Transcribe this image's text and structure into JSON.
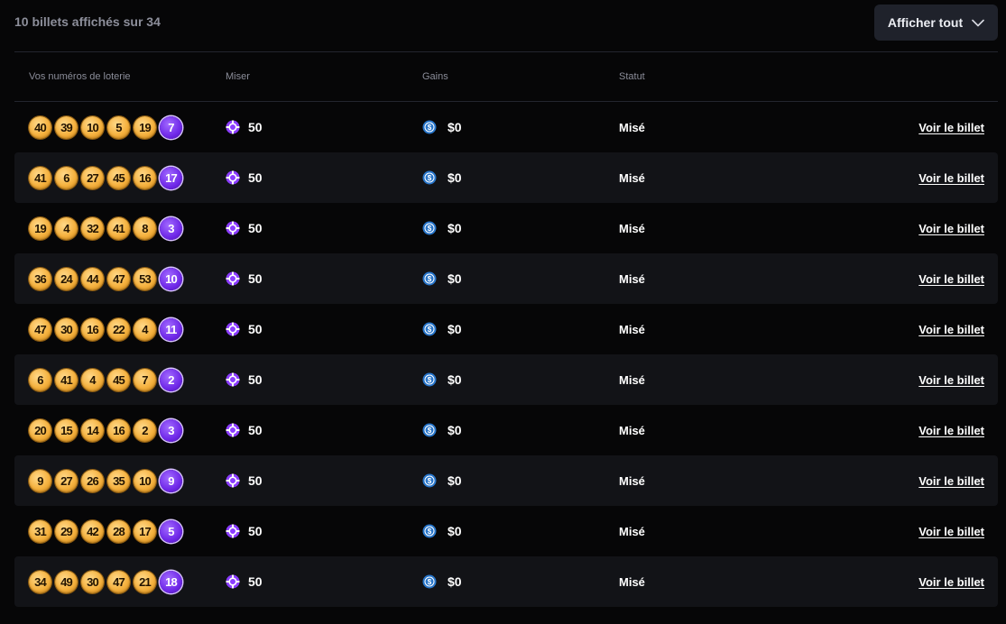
{
  "summary": {
    "count_text": "10 billets affichés sur 34"
  },
  "filter": {
    "label": "Afficher tout",
    "icon": "chevron-down-icon"
  },
  "table": {
    "headers": {
      "numbers": "Vos numéros de loterie",
      "bet": "Miser",
      "winnings": "Gains",
      "status": "Statut"
    },
    "rows": [
      {
        "numbers": [
          "40",
          "39",
          "10",
          "5",
          "19"
        ],
        "bonus": "7",
        "bet": "50",
        "winnings": "$0",
        "status": "Misé",
        "link": "Voir le billet"
      },
      {
        "numbers": [
          "41",
          "6",
          "27",
          "45",
          "16"
        ],
        "bonus": "17",
        "bet": "50",
        "winnings": "$0",
        "status": "Misé",
        "link": "Voir le billet"
      },
      {
        "numbers": [
          "19",
          "4",
          "32",
          "41",
          "8"
        ],
        "bonus": "3",
        "bet": "50",
        "winnings": "$0",
        "status": "Misé",
        "link": "Voir le billet"
      },
      {
        "numbers": [
          "36",
          "24",
          "44",
          "47",
          "53"
        ],
        "bonus": "10",
        "bet": "50",
        "winnings": "$0",
        "status": "Misé",
        "link": "Voir le billet"
      },
      {
        "numbers": [
          "47",
          "30",
          "16",
          "22",
          "4"
        ],
        "bonus": "11",
        "bet": "50",
        "winnings": "$0",
        "status": "Misé",
        "link": "Voir le billet"
      },
      {
        "numbers": [
          "6",
          "41",
          "4",
          "45",
          "7"
        ],
        "bonus": "2",
        "bet": "50",
        "winnings": "$0",
        "status": "Misé",
        "link": "Voir le billet"
      },
      {
        "numbers": [
          "20",
          "15",
          "14",
          "16",
          "2"
        ],
        "bonus": "3",
        "bet": "50",
        "winnings": "$0",
        "status": "Misé",
        "link": "Voir le billet"
      },
      {
        "numbers": [
          "9",
          "27",
          "26",
          "35",
          "10"
        ],
        "bonus": "9",
        "bet": "50",
        "winnings": "$0",
        "status": "Misé",
        "link": "Voir le billet"
      },
      {
        "numbers": [
          "31",
          "29",
          "42",
          "28",
          "17"
        ],
        "bonus": "5",
        "bet": "50",
        "winnings": "$0",
        "status": "Misé",
        "link": "Voir le billet"
      },
      {
        "numbers": [
          "34",
          "49",
          "30",
          "47",
          "21"
        ],
        "bonus": "18",
        "bet": "50",
        "winnings": "$0",
        "status": "Misé",
        "link": "Voir le billet"
      }
    ]
  },
  "icons": {
    "bet": "chip-icon",
    "winnings": "usdc-coin-icon"
  },
  "colors": {
    "gold_ball": "#f5b13e",
    "bonus_ball": "#6f28e8",
    "chip": "#8b3dff",
    "coin": "#2775ca"
  }
}
